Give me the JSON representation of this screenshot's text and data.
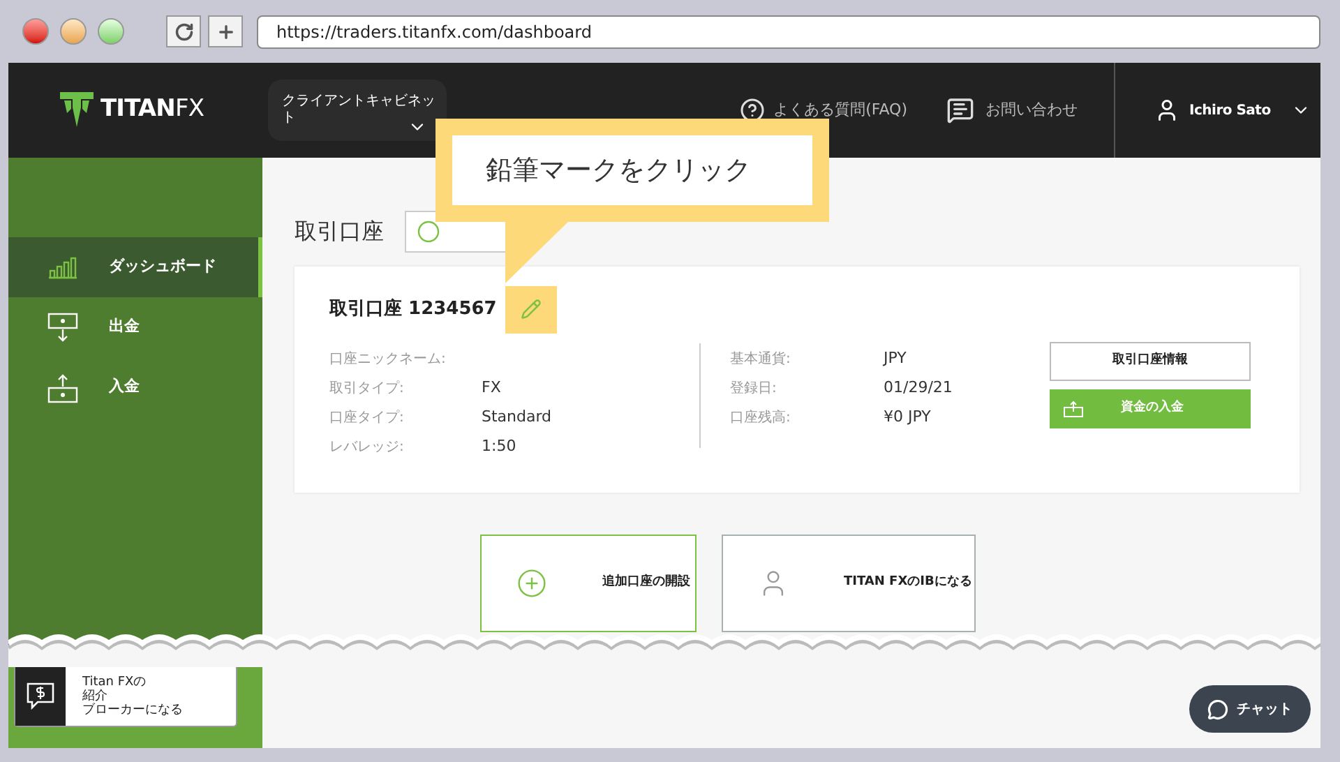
{
  "browser": {
    "url": "https://traders.titanfx.com/dashboard"
  },
  "header": {
    "logo_text": "TITAN",
    "logo_suffix": "FX",
    "cabinet_menu": "クライアントキャビネット",
    "faq": "よくある質問(FAQ)",
    "contact": "お問い合わせ",
    "user": "Ichiro Sato"
  },
  "sidebar": {
    "items": [
      {
        "label": "ダッシュボード",
        "kind": "chart",
        "selected": true
      },
      {
        "label": "出金",
        "kind": "withdraw",
        "selected": false
      },
      {
        "label": "入金",
        "kind": "deposit",
        "selected": false
      }
    ]
  },
  "page_title": "取引口座",
  "callout": "鉛筆マークをクリック",
  "account": {
    "title": "取引口座 1234567",
    "left_fields": [
      {
        "label": "口座ニックネーム:"
      },
      {
        "label": "取引タイプ:",
        "value": "FX"
      },
      {
        "label": "口座タイプ:",
        "value": "Standard"
      },
      {
        "label": "レバレッジ:",
        "value": "1:50"
      }
    ],
    "right_fields": [
      {
        "label": "基本通貨:",
        "value": "JPY"
      },
      {
        "label": "登録日:",
        "value": "01/29/21"
      },
      {
        "label": "口座残高:",
        "value": "¥0 JPY"
      }
    ],
    "buttons": [
      {
        "label": "取引口座情報",
        "kind": "outline"
      },
      {
        "label": "資金の入金",
        "kind": "primary"
      }
    ]
  },
  "actions": [
    {
      "label": "追加口座の開設",
      "kind": "add"
    },
    {
      "label": "TITAN FXのIBになる",
      "kind": "ib"
    }
  ],
  "referral": {
    "lines": [
      "Titan FXの",
      "紹介",
      "ブローカーになる"
    ]
  },
  "chat": "チャット"
}
